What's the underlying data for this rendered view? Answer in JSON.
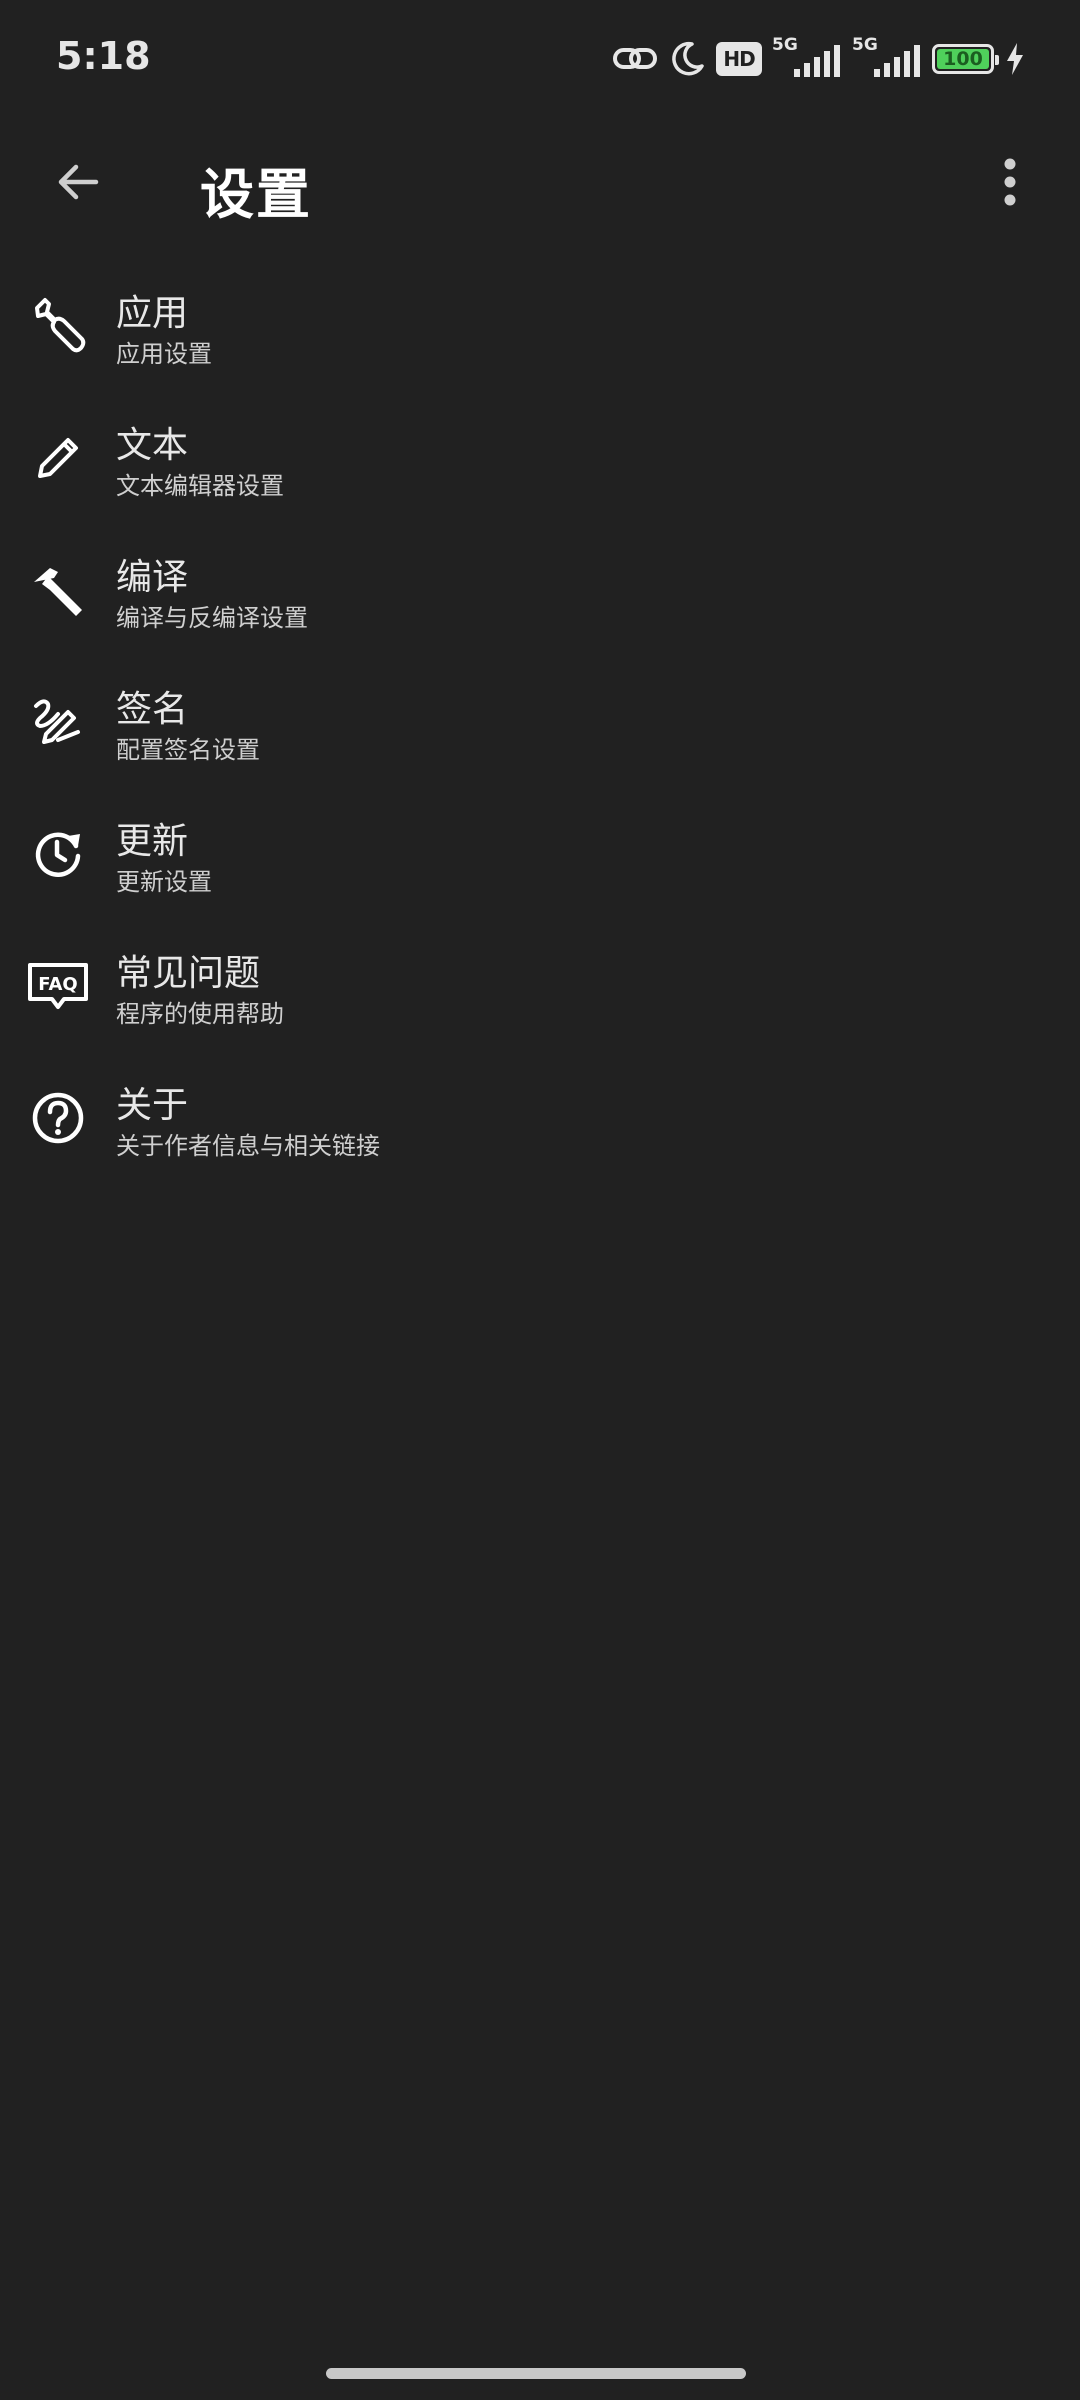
{
  "status_bar": {
    "time": "5:18",
    "hd_label": "HD",
    "signal1_label": "5G",
    "signal2_label": "5G",
    "battery_level": "100"
  },
  "app_bar": {
    "title": "设置"
  },
  "settings": {
    "items": [
      {
        "title": "应用",
        "subtitle": "应用设置",
        "icon": "wrench-icon"
      },
      {
        "title": "文本",
        "subtitle": "文本编辑器设置",
        "icon": "pencil-icon"
      },
      {
        "title": "编译",
        "subtitle": "编译与反编译设置",
        "icon": "hammer-icon"
      },
      {
        "title": "签名",
        "subtitle": "配置签名设置",
        "icon": "signature-icon"
      },
      {
        "title": "更新",
        "subtitle": "更新设置",
        "icon": "update-clock-icon"
      },
      {
        "title": "常见问题",
        "subtitle": "程序的使用帮助",
        "icon": "faq-icon"
      },
      {
        "title": "关于",
        "subtitle": "关于作者信息与相关链接",
        "icon": "help-circle-icon"
      }
    ]
  },
  "colors": {
    "background": "#212121",
    "text_primary": "#e8e8e8",
    "text_secondary": "#cfcfcf",
    "battery_fill": "#4fd05b"
  }
}
